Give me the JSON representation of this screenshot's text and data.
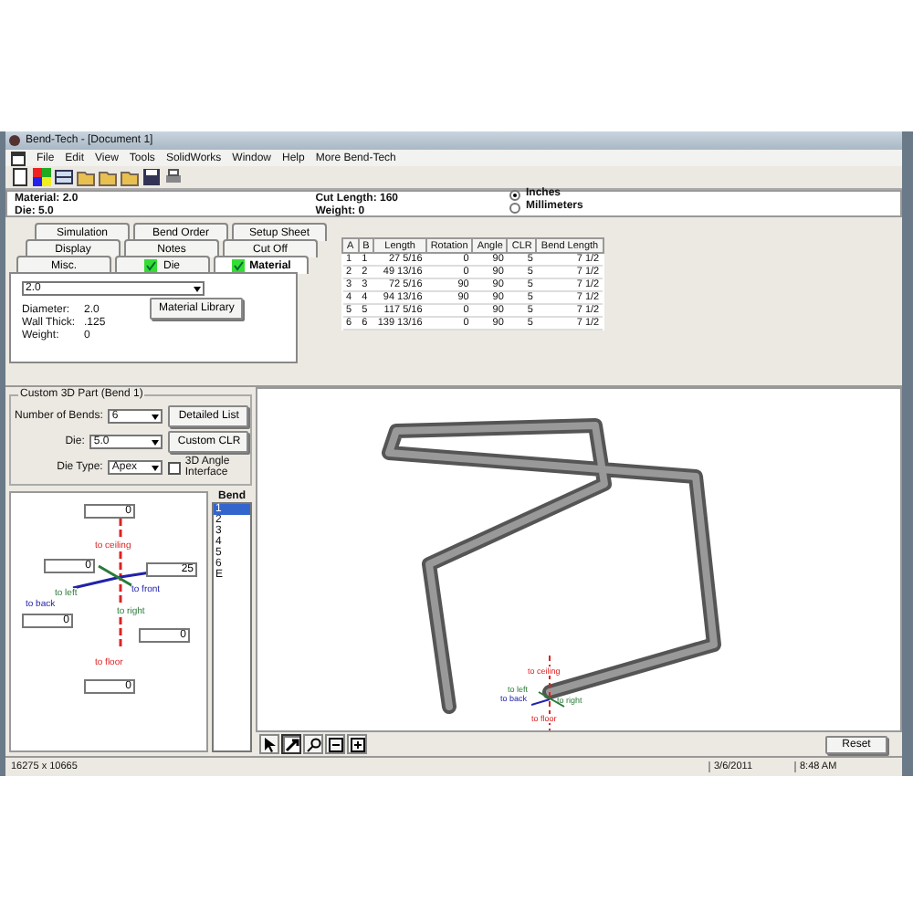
{
  "window": {
    "title": "Bend-Tech - [Document 1]"
  },
  "menu": [
    "File",
    "Edit",
    "View",
    "Tools",
    "SolidWorks",
    "Window",
    "Help",
    "More Bend-Tech"
  ],
  "info": {
    "material": "Material: 2.0",
    "die": "Die: 5.0",
    "cut_length": "Cut Length: 160",
    "weight": "Weight: 0"
  },
  "units": [
    {
      "label": "Inches",
      "selected": true
    },
    {
      "label": "Millimeters",
      "selected": false
    }
  ],
  "tab_rows": [
    [
      {
        "label": "Simulation",
        "checked": false,
        "selected": false
      },
      {
        "label": "Bend Order",
        "checked": false,
        "selected": false
      },
      {
        "label": "Setup Sheet",
        "checked": false,
        "selected": false
      }
    ],
    [
      {
        "label": "Display",
        "checked": false,
        "selected": false
      },
      {
        "label": "Notes",
        "checked": false,
        "selected": false
      },
      {
        "label": "Cut Off",
        "checked": false,
        "selected": false
      }
    ],
    [
      {
        "label": "Misc.",
        "checked": false,
        "selected": false
      },
      {
        "label": "Die",
        "checked": true,
        "selected": false
      },
      {
        "label": "Material",
        "checked": true,
        "selected": true
      }
    ]
  ],
  "material_panel": {
    "dropdown": "2.0",
    "button": "Material Library",
    "props": [
      {
        "label": "Diameter:",
        "value": "2.0"
      },
      {
        "label": "Wall Thick:",
        "value": ".125"
      },
      {
        "label": "Weight:",
        "value": "0"
      }
    ]
  },
  "table": {
    "columns": [
      "A",
      "B",
      "Length",
      "Rotation",
      "Angle",
      "CLR",
      "Bend Length"
    ],
    "rows": [
      [
        "1",
        "1",
        "27 5/16",
        "0",
        "90",
        "5",
        "7 1/2"
      ],
      [
        "2",
        "2",
        "49 13/16",
        "0",
        "90",
        "5",
        "7 1/2"
      ],
      [
        "3",
        "3",
        "72 5/16",
        "90",
        "90",
        "5",
        "7 1/2"
      ],
      [
        "4",
        "4",
        "94 13/16",
        "90",
        "90",
        "5",
        "7 1/2"
      ],
      [
        "5",
        "5",
        "117 5/16",
        "0",
        "90",
        "5",
        "7 1/2"
      ],
      [
        "6",
        "6",
        "139 13/16",
        "0",
        "90",
        "5",
        "7 1/2"
      ]
    ]
  },
  "custom_part": {
    "title": "Custom 3D Part (Bend 1)",
    "bends_label": "Number of Bends:",
    "bends": "6",
    "die_label": "Die:",
    "die": "5.0",
    "die_type_label": "Die Type:",
    "die_type": "Apex",
    "buttons": [
      "Detailed List",
      "Custom CLR"
    ],
    "angle_checkbox": {
      "label": "3D Angle Interface",
      "checked": false
    }
  },
  "direction": {
    "fields": [
      "0",
      "0",
      "25",
      "0",
      "0",
      "0"
    ],
    "labels": [
      "to ceiling",
      "to left",
      "to front",
      "to back",
      "to right",
      "to floor"
    ]
  },
  "bend_list": {
    "header": "Bend",
    "items": [
      {
        "label": "1",
        "selected": true
      },
      {
        "label": "2",
        "selected": false
      },
      {
        "label": "3",
        "selected": false
      },
      {
        "label": "4",
        "selected": false
      },
      {
        "label": "5",
        "selected": false
      },
      {
        "label": "6",
        "selected": false
      },
      {
        "label": "E",
        "selected": false
      }
    ]
  },
  "viewport": {
    "axis_labels": [
      "to ceiling",
      "to left",
      "to back",
      "to right",
      "to floor"
    ]
  },
  "view_tools": [
    {
      "kind": "pointer",
      "selected": false
    },
    {
      "kind": "rotate",
      "selected": true
    },
    {
      "kind": "zoom",
      "selected": false
    },
    {
      "kind": "fit",
      "selected": false
    },
    {
      "kind": "zoombox",
      "selected": false
    }
  ],
  "reset": "Reset",
  "status_bar": {
    "size": "16275 x 10665",
    "date": "3/6/2011",
    "time": "8:48 AM"
  }
}
